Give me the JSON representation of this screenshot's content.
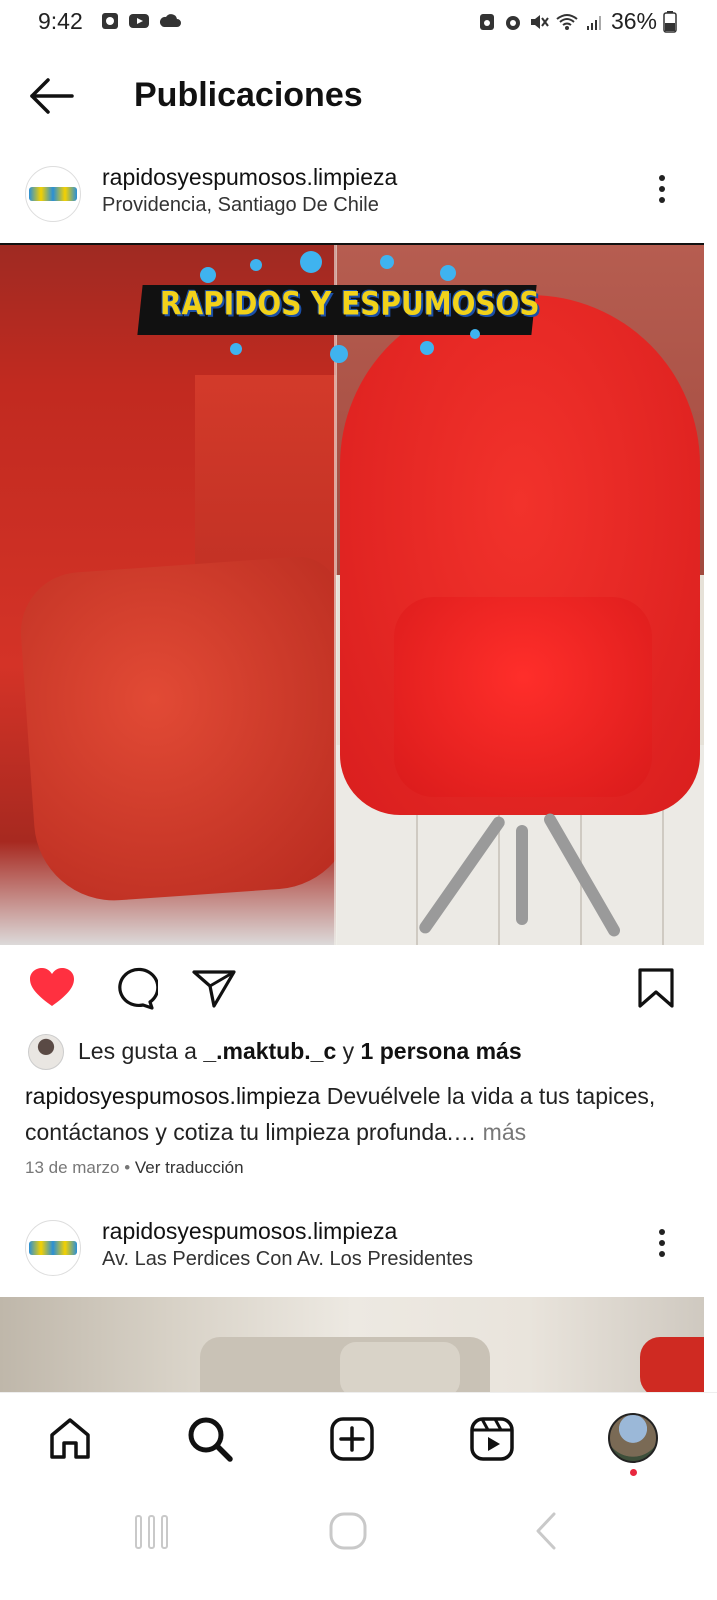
{
  "status_bar": {
    "time": "9:42",
    "battery": "36%"
  },
  "header": {
    "title": "Publicaciones"
  },
  "post1": {
    "username": "rapidosyespumosos.limpieza",
    "location": "Providencia, Santiago De Chile",
    "image_logo_text": "RAPIDOS Y ESPUMOSOS",
    "likes": {
      "prefix": "Les gusta a ",
      "user": "_.maktub._c",
      "middle": " y ",
      "others": "1 persona más"
    },
    "caption": {
      "username": "rapidosyespumosos.limpieza",
      "text": " Devuélvele la vida a tus tapices, contáctanos y cotiza tu limpieza profunda.…",
      "more": " más"
    },
    "date": "13 de marzo",
    "separator": " • ",
    "translate": "Ver traducción",
    "liked": true
  },
  "post2": {
    "username": "rapidosyespumosos.limpieza",
    "location": "Av. Las Perdices Con Av. Los Presidentes"
  },
  "bottom_nav": {
    "items": [
      "home-icon",
      "search-icon",
      "create-icon",
      "reels-icon",
      "profile-avatar"
    ]
  },
  "colors": {
    "like_red": "#ff3040",
    "notification": "#e8273e",
    "text": "#111111",
    "muted": "#777777"
  }
}
